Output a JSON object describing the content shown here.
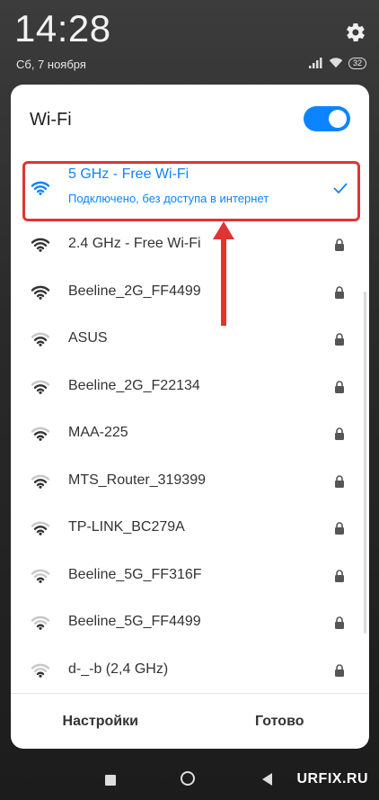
{
  "status_bar": {
    "time": "14:28",
    "date": "Сб, 7 ноября",
    "battery": "32"
  },
  "dialog": {
    "title": "Wi-Fi",
    "toggle_on": true,
    "accent_color": "#0d84ff",
    "highlight_color": "#e03434",
    "networks": [
      {
        "name": "5 GHz - Free Wi-Fi",
        "status": "Подключено, без доступа в интернет",
        "connected": true,
        "signal": 4,
        "locked": false
      },
      {
        "name": "2.4 GHz - Free Wi-Fi",
        "status": "",
        "connected": false,
        "signal": 4,
        "locked": true
      },
      {
        "name": "Beeline_2G_FF4499",
        "status": "",
        "connected": false,
        "signal": 4,
        "locked": true
      },
      {
        "name": "ASUS",
        "status": "",
        "connected": false,
        "signal": 3,
        "locked": true
      },
      {
        "name": "Beeline_2G_F22134",
        "status": "",
        "connected": false,
        "signal": 3,
        "locked": true
      },
      {
        "name": "MAA-225",
        "status": "",
        "connected": false,
        "signal": 3,
        "locked": true
      },
      {
        "name": "MTS_Router_319399",
        "status": "",
        "connected": false,
        "signal": 3,
        "locked": true
      },
      {
        "name": "TP-LINK_BC279A",
        "status": "",
        "connected": false,
        "signal": 3,
        "locked": true
      },
      {
        "name": "Beeline_5G_FF316F",
        "status": "",
        "connected": false,
        "signal": 2,
        "locked": true
      },
      {
        "name": "Beeline_5G_FF4499",
        "status": "",
        "connected": false,
        "signal": 2,
        "locked": true
      },
      {
        "name": "d-_-b (2,4 GHz)",
        "status": "",
        "connected": false,
        "signal": 2,
        "locked": true
      }
    ],
    "footer": {
      "settings_label": "Настройки",
      "done_label": "Готово"
    }
  },
  "watermark": "URFIX.RU"
}
